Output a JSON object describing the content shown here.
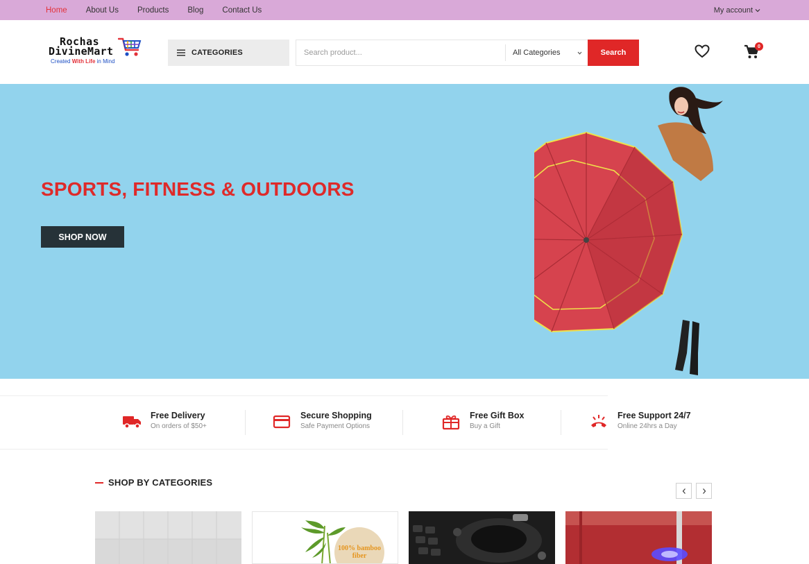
{
  "topbar": {
    "nav": [
      {
        "label": "Home",
        "active": true
      },
      {
        "label": "About Us",
        "active": false
      },
      {
        "label": "Products",
        "active": false
      },
      {
        "label": "Blog",
        "active": false
      },
      {
        "label": "Contact Us",
        "active": false
      }
    ],
    "account_label": "My account",
    "background": "#d9a9d8"
  },
  "header": {
    "logo": {
      "line1": "Rochas",
      "line2": "DivineMart",
      "tagline_pre": "Created",
      "tagline_mid": "With Life",
      "tagline_post": "in Mind"
    },
    "categories_label": "CATEGORIES",
    "search": {
      "placeholder": "Search product...",
      "category_selected": "All Categories",
      "button_label": "Search"
    },
    "cart_count": "0",
    "icons": [
      "menu-icon",
      "heart-icon",
      "cart-icon",
      "chevron-down-icon"
    ]
  },
  "hero": {
    "title": "SPORTS, FITNESS & OUTDOORS",
    "button_label": "SHOP NOW",
    "background": "#92d3ed",
    "title_color": "#de2a2a"
  },
  "features": [
    {
      "icon": "truck-icon",
      "title": "Free Delivery",
      "subtitle": "On orders of $50+"
    },
    {
      "icon": "credit-card-icon",
      "title": "Secure Shopping",
      "subtitle": "Safe Payment Options"
    },
    {
      "icon": "gift-icon",
      "title": "Free Gift Box",
      "subtitle": "Buy a Gift"
    },
    {
      "icon": "phone-support-icon",
      "title": "Free Support 24/7",
      "subtitle": "Online 24hrs a Day"
    }
  ],
  "categories_section": {
    "title": "SHOP BY CATEGORIES",
    "accent": "#e02727"
  }
}
